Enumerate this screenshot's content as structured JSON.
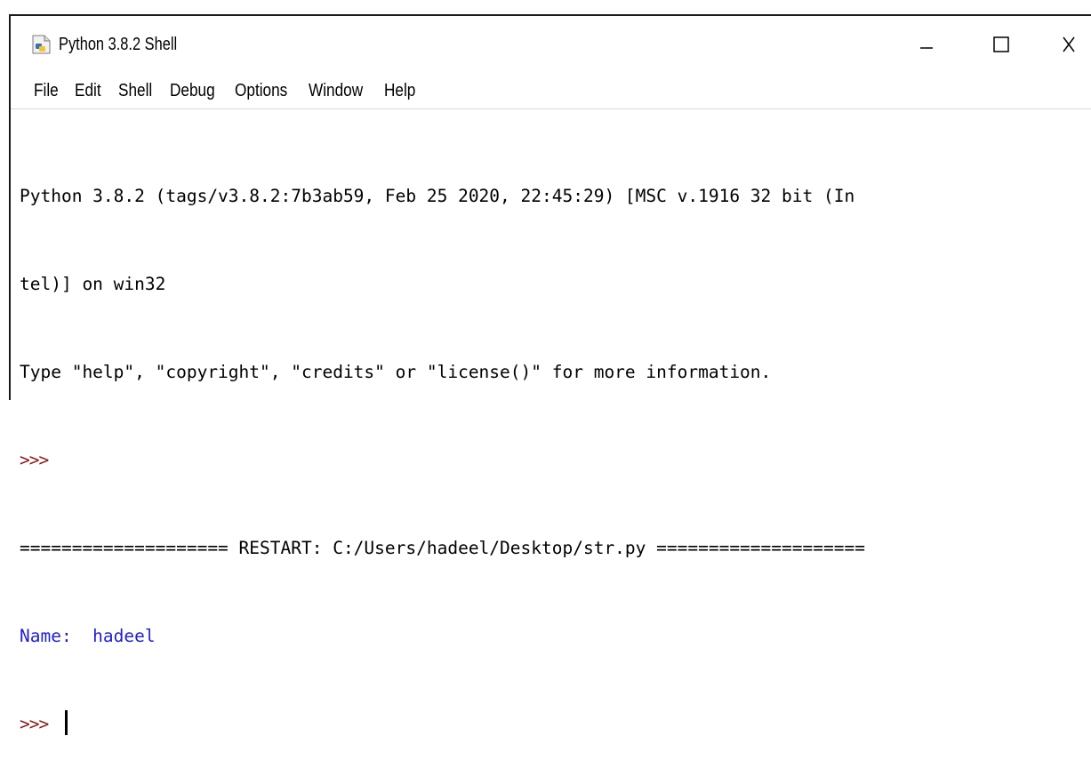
{
  "window": {
    "title": "Python 3.8.2 Shell",
    "controls": {
      "minimize": "–",
      "maximize": "□",
      "close": "X"
    }
  },
  "menu": [
    "File",
    "Edit",
    "Shell",
    "Debug",
    "Options",
    "Window",
    "Help"
  ],
  "shell": {
    "banner_line1": "Python 3.8.2 (tags/v3.8.2:7b3ab59, Feb 25 2020, 22:45:29) [MSC v.1916 32 bit (In",
    "banner_line2": "tel)] on win32",
    "banner_line3": "Type \"help\", \"copyright\", \"credits\" or \"license()\" for more information.",
    "prompt": ">>>",
    "restart_line": "==================== RESTART: C:/Users/hadeel/Desktop/str.py ====================",
    "output_line": "Name:  hadeel",
    "final_prompt": ">>> "
  },
  "colors": {
    "prompt": "#8a1a1a",
    "output": "#1f1fd1",
    "text": "#000000"
  },
  "icons": {
    "app": "python-idle-icon"
  }
}
